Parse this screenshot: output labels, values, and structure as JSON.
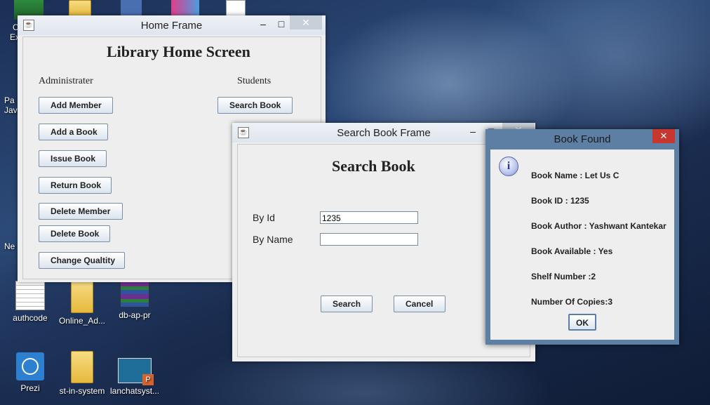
{
  "desktop": {
    "icons": [
      {
        "label": "authcode",
        "icon": "notepad-icon"
      },
      {
        "label": "Online_Ad...",
        "icon": "folder-icon"
      },
      {
        "label": "db-ap-pr",
        "icon": "winrar-icon"
      },
      {
        "label": "Prezi",
        "icon": "prezi-icon"
      },
      {
        "label": "st-in-system",
        "icon": "folder-icon"
      },
      {
        "label": "lanchatsyst...",
        "icon": "powerpoint-icon"
      }
    ],
    "partial_labels": [
      "C",
      "Ex",
      "Pa",
      "Jav",
      "Ne"
    ]
  },
  "home_frame": {
    "title": "Home Frame",
    "heading": "Library Home Screen",
    "admin_label": "Administrater",
    "students_label": "Students",
    "admin_buttons": [
      "Add Member",
      "Add a Book",
      "Issue Book",
      "Return Book",
      "Delete Member",
      "Delete Book",
      "Change Qualtity"
    ],
    "student_buttons": [
      "Search Book"
    ]
  },
  "search_frame": {
    "title": "Search Book Frame",
    "heading": "Search Book",
    "by_id_label": "By Id",
    "by_id_value": "1235",
    "by_name_label": "By Name",
    "by_name_value": "",
    "search_button": "Search",
    "cancel_button": "Cancel"
  },
  "dialog": {
    "title": "Book Found",
    "icon": "info-icon",
    "lines": [
      "Book Name : Let Us C",
      "Book ID : 1235",
      "Book Author : Yashwant Kantekar",
      "Book Available : Yes",
      "Shelf Number :2",
      "Number Of Copies:3"
    ],
    "ok_button": "OK"
  },
  "colors": {
    "dialog_titlebar": "#5d7fa3",
    "close_red": "#c7372f",
    "window_bg": "#eeeeee"
  }
}
